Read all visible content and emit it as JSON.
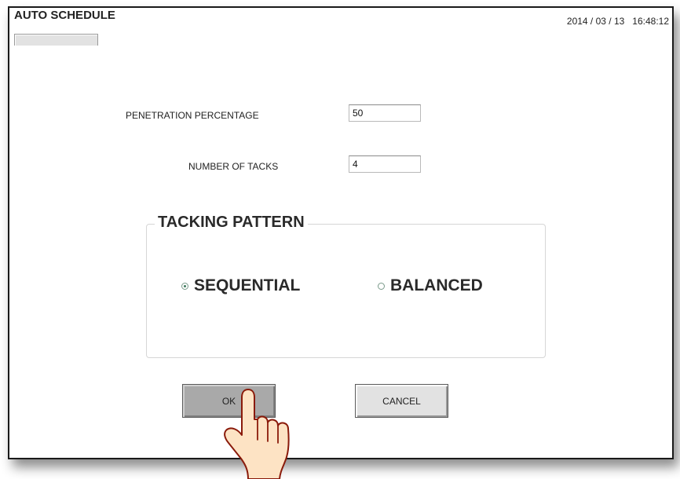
{
  "window": {
    "title": "AUTO SCHEDULE",
    "datetime": "2014 / 03 / 13   16:48:12"
  },
  "form": {
    "penetration": {
      "label": "PENETRATION PERCENTAGE",
      "value": "50"
    },
    "tacks": {
      "label": "NUMBER OF TACKS",
      "value": "4"
    }
  },
  "tacking_pattern": {
    "legend": "TACKING PATTERN",
    "options": [
      {
        "label": "SEQUENTIAL",
        "selected": true
      },
      {
        "label": "BALANCED",
        "selected": false
      }
    ]
  },
  "buttons": {
    "ok_label": "OK",
    "cancel_label": "CANCEL"
  },
  "icons": {
    "pointer": "pointing-hand-cursor-icon"
  },
  "colors": {
    "ok_button": "#a9a9a9",
    "cancel_button": "#e2e2e2",
    "radio_selected": "#3e7a5e",
    "hand_fill": "#fde3c4",
    "hand_outline": "#8a1a0a"
  }
}
